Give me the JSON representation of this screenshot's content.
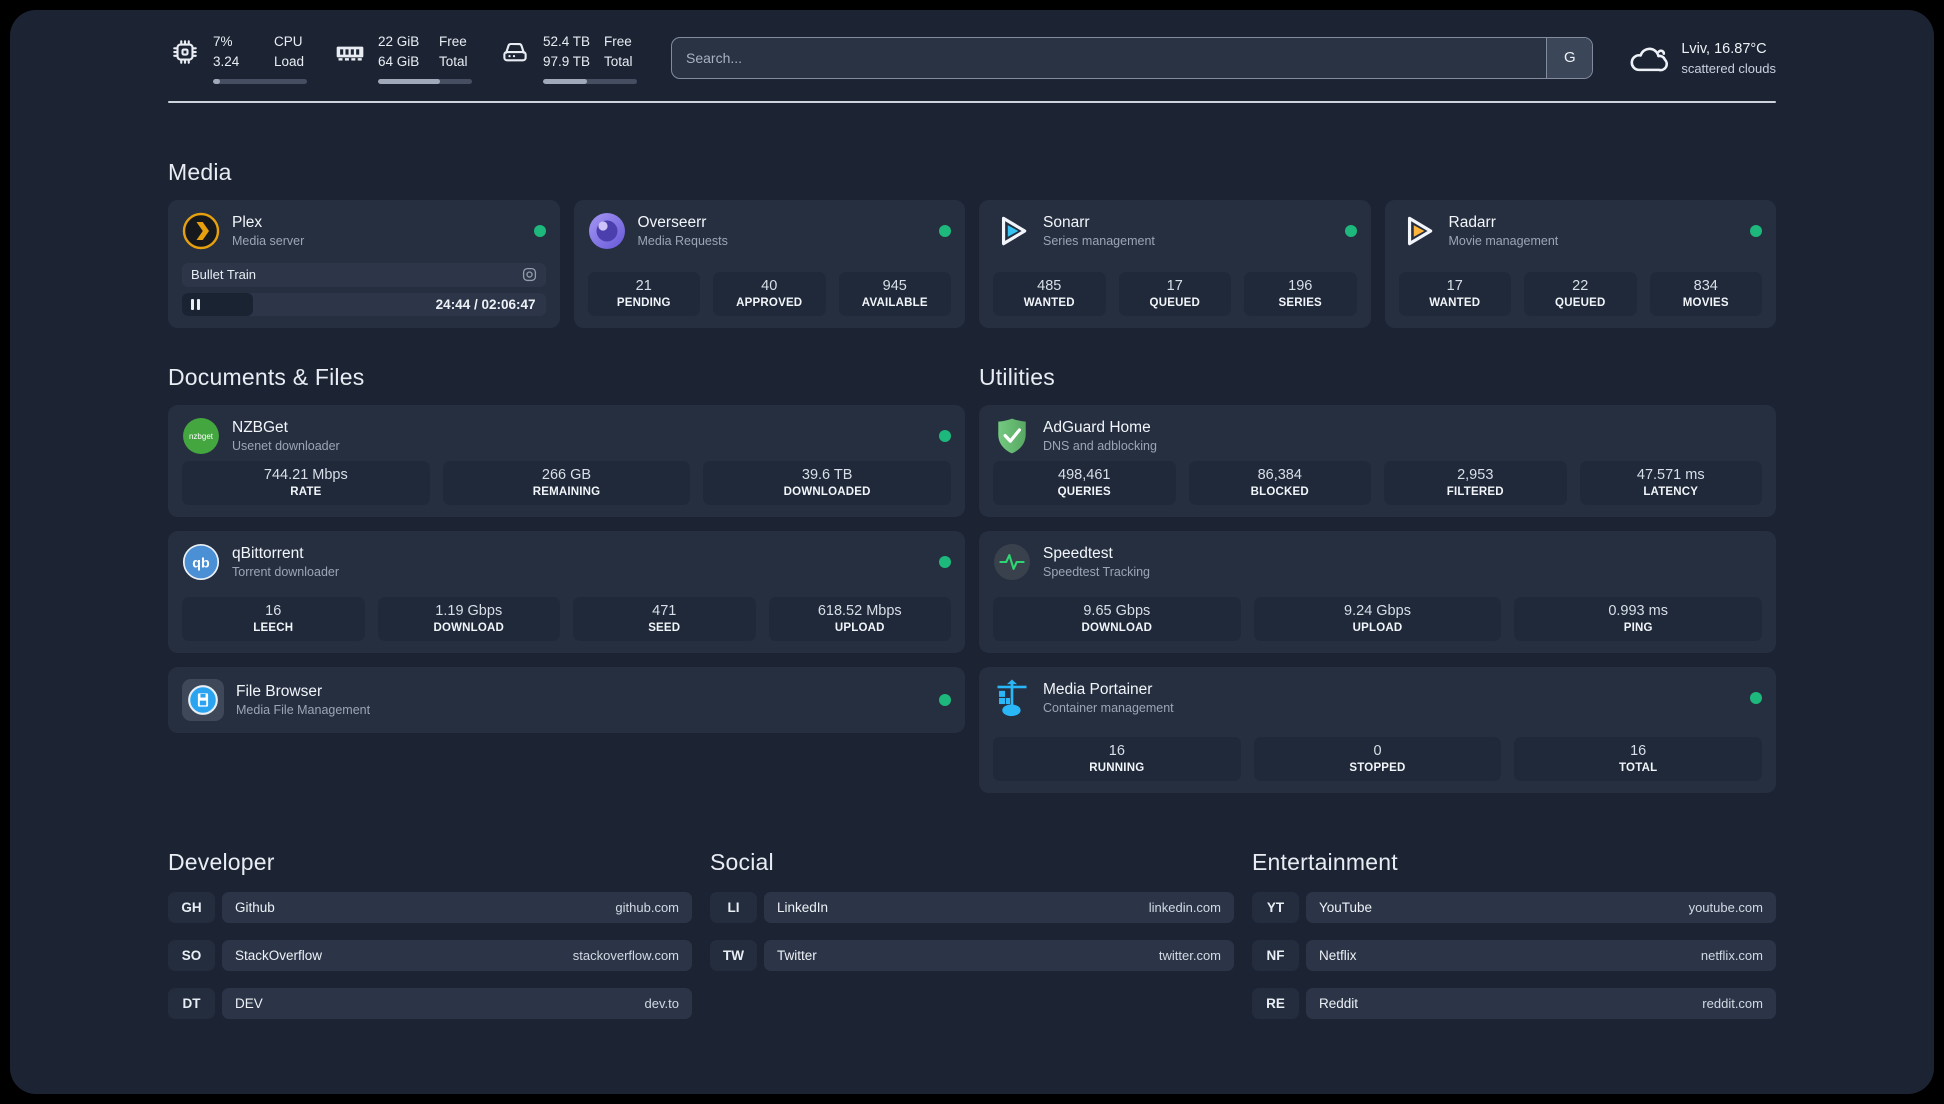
{
  "header": {
    "metrics": [
      {
        "icon": "cpu-icon",
        "value1": "7%",
        "value2": "3.24",
        "label1": "CPU",
        "label2": "Load",
        "fill_percent": 7
      },
      {
        "icon": "ram-icon",
        "value1": "22 GiB",
        "value2": "64 GiB",
        "label1": "Free",
        "label2": "Total",
        "fill_percent": 66
      },
      {
        "icon": "disk-icon",
        "value1": "52.4 TB",
        "value2": "97.9 TB",
        "label1": "Free",
        "label2": "Total",
        "fill_percent": 47
      }
    ],
    "search": {
      "placeholder": "Search...",
      "button": "G"
    },
    "weather": {
      "location_temp": "Lviv, 16.87°C",
      "condition": "scattered clouds"
    }
  },
  "sections": {
    "media": {
      "title": "Media",
      "plex": {
        "name": "Plex",
        "subtitle": "Media server",
        "status": "online",
        "player": {
          "title": "Bullet Train",
          "time": "24:44 / 02:06:47",
          "progress_percent": 19.5
        }
      },
      "overseerr": {
        "name": "Overseerr",
        "subtitle": "Media Requests",
        "status": "online",
        "stats": [
          {
            "value": "21",
            "label": "PENDING"
          },
          {
            "value": "40",
            "label": "APPROVED"
          },
          {
            "value": "945",
            "label": "AVAILABLE"
          }
        ]
      },
      "sonarr": {
        "name": "Sonarr",
        "subtitle": "Series management",
        "status": "online",
        "stats": [
          {
            "value": "485",
            "label": "WANTED"
          },
          {
            "value": "17",
            "label": "QUEUED"
          },
          {
            "value": "196",
            "label": "SERIES"
          }
        ]
      },
      "radarr": {
        "name": "Radarr",
        "subtitle": "Movie management",
        "status": "online",
        "stats": [
          {
            "value": "17",
            "label": "WANTED"
          },
          {
            "value": "22",
            "label": "QUEUED"
          },
          {
            "value": "834",
            "label": "MOVIES"
          }
        ]
      }
    },
    "documents": {
      "title": "Documents & Files",
      "nzbget": {
        "name": "NZBGet",
        "subtitle": "Usenet downloader",
        "status": "online",
        "icon_text": "nzbget",
        "stats": [
          {
            "value": "744.21 Mbps",
            "label": "RATE"
          },
          {
            "value": "266 GB",
            "label": "REMAINING"
          },
          {
            "value": "39.6 TB",
            "label": "DOWNLOADED"
          }
        ]
      },
      "qbittorrent": {
        "name": "qBittorrent",
        "subtitle": "Torrent downloader",
        "status": "online",
        "icon_text": "qb",
        "stats": [
          {
            "value": "16",
            "label": "LEECH"
          },
          {
            "value": "1.19 Gbps",
            "label": "DOWNLOAD"
          },
          {
            "value": "471",
            "label": "SEED"
          },
          {
            "value": "618.52 Mbps",
            "label": "UPLOAD"
          }
        ]
      },
      "filebrowser": {
        "name": "File Browser",
        "subtitle": "Media File Management",
        "status": "online"
      }
    },
    "utilities": {
      "title": "Utilities",
      "adguard": {
        "name": "AdGuard Home",
        "subtitle": "DNS and adblocking",
        "stats": [
          {
            "value": "498,461",
            "label": "QUERIES"
          },
          {
            "value": "86,384",
            "label": "BLOCKED"
          },
          {
            "value": "2,953",
            "label": "FILTERED"
          },
          {
            "value": "47.571 ms",
            "label": "LATENCY"
          }
        ]
      },
      "speedtest": {
        "name": "Speedtest",
        "subtitle": "Speedtest Tracking",
        "stats": [
          {
            "value": "9.65 Gbps",
            "label": "DOWNLOAD"
          },
          {
            "value": "9.24 Gbps",
            "label": "UPLOAD"
          },
          {
            "value": "0.993 ms",
            "label": "PING"
          }
        ]
      },
      "portainer": {
        "name": "Media Portainer",
        "subtitle": "Container management",
        "status": "online",
        "stats": [
          {
            "value": "16",
            "label": "RUNNING"
          },
          {
            "value": "0",
            "label": "STOPPED"
          },
          {
            "value": "16",
            "label": "TOTAL"
          }
        ]
      }
    },
    "developer": {
      "title": "Developer",
      "links": [
        {
          "abbr": "GH",
          "name": "Github",
          "url": "github.com"
        },
        {
          "abbr": "SO",
          "name": "StackOverflow",
          "url": "stackoverflow.com"
        },
        {
          "abbr": "DT",
          "name": "DEV",
          "url": "dev.to"
        }
      ]
    },
    "social": {
      "title": "Social",
      "links": [
        {
          "abbr": "LI",
          "name": "LinkedIn",
          "url": "linkedin.com"
        },
        {
          "abbr": "TW",
          "name": "Twitter",
          "url": "twitter.com"
        }
      ]
    },
    "entertainment": {
      "title": "Entertainment",
      "links": [
        {
          "abbr": "YT",
          "name": "YouTube",
          "url": "youtube.com"
        },
        {
          "abbr": "NF",
          "name": "Netflix",
          "url": "netflix.com"
        },
        {
          "abbr": "RE",
          "name": "Reddit",
          "url": "reddit.com"
        }
      ]
    }
  },
  "colors": {
    "background": "#1c2434",
    "card": "#262f40",
    "tile": "#1f2939",
    "status_green": "#1db87b",
    "plex_amber": "#e6a00e",
    "sonarr_blue": "#36c3f1",
    "radarr_amber": "#ffb53c",
    "portainer_blue": "#2ab7f7"
  }
}
